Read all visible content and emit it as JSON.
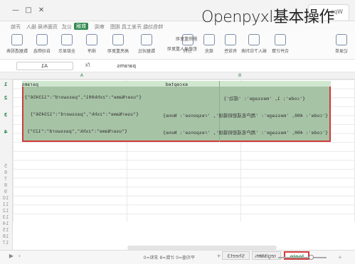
{
  "overlay": {
    "title": "Openpyxl基本操作"
  },
  "window": {
    "tab_label": "Wps",
    "controls": [
      "—",
      "□",
      "✕"
    ]
  },
  "menu": {
    "items": [
      "开始",
      "插入",
      "页面布局",
      "公式",
      "数据",
      "审阅",
      "视图",
      "开发工具",
      "特色功能"
    ],
    "active": "数据"
  },
  "ribbon": {
    "buttons": [
      {
        "label": "数据透视表",
        "icon": "pivot-table-icon"
      },
      {
        "label": "自动筛选",
        "icon": "filter-icon"
      },
      {
        "label": "全部显示",
        "icon": "show-all-icon"
      },
      {
        "label": "排序",
        "icon": "sort-icon"
      },
      {
        "label": "高亮重复项",
        "icon": "highlight-duplicates-icon"
      },
      {
        "label": "数据对比",
        "icon": "compare-icon"
      },
      {
        "label": "分列",
        "icon": "split-columns-icon"
      },
      {
        "label": "填充",
        "icon": "fill-icon"
      },
      {
        "label": "有效性",
        "icon": "validation-icon"
      },
      {
        "label": "插入下拉列表",
        "icon": "dropdown-list-icon"
      },
      {
        "label": "合并计算",
        "icon": "consolidate-icon"
      },
      {
        "label": "记录单",
        "icon": "form-icon"
      }
    ],
    "small": [
      "删除重复项",
      "拒绝录入重复项"
    ]
  },
  "formula_bar": {
    "cell_ref": "A1",
    "fx": "fx",
    "value": "params"
  },
  "columns": [
    "A",
    "B"
  ],
  "rows": [
    "1",
    "2",
    "3",
    "4",
    "5",
    "6",
    "7",
    "8",
    "9",
    "10",
    "11",
    "12",
    "13",
    "14",
    "15",
    "16",
    "17"
  ],
  "sheet": {
    "headers": {
      "a": "params",
      "b": "excepted"
    },
    "data": [
      {
        "a": "{\"userName\":\"zxhk001\",\"password\":\"123456\"}",
        "b": "{'code': 1, 'message': '成功'}"
      },
      {
        "a": "{\"userName\":\"zxhk\",\"password\":\"123456\"}",
        "b": "{'code': 400, 'message': '用户名或密码错误', 'response': None}"
      },
      {
        "a": "{\"userName\":\"zxhk\",\"password\":\"123\"}",
        "b": "{'code': 400, 'message': '用户名或密码错误', 'response': None}"
      }
    ]
  },
  "sheet_tabs": {
    "items": [
      "login",
      "register",
      "Sheet3"
    ],
    "active": "login"
  },
  "status": {
    "zoom": "100%",
    "summary": "平均值=0 计数=8 求和=0"
  },
  "colors": {
    "accent": "#2f8a4e",
    "selection": "#a7c3a6",
    "highlight_border": "#d23a3a"
  }
}
